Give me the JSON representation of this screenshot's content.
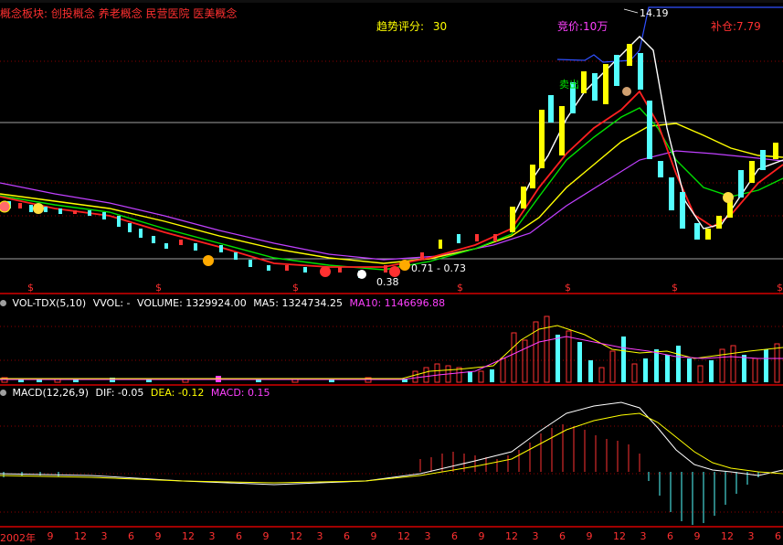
{
  "header": {
    "concept_prefix": "概念板块:",
    "concepts": "创投概念 养老概念 民营医院 医美概念",
    "trend_label": "趋势评分:",
    "trend_value": "30",
    "bid_label": "竞价:",
    "bid_value": "10万",
    "refill_label": "补仓:",
    "refill_value": "7.79"
  },
  "main_chart": {
    "high_label": "14.19",
    "low_label": "0.38",
    "range_label": "0.71 - 0.73",
    "sell_label": "卖出",
    "s_marker": "$"
  },
  "vol_panel": {
    "dot_icon": "circle-icon",
    "indicator": "VOL-TDX(5,10)",
    "vvol": "VVOL: -",
    "volume": "VOLUME: 1329924.00",
    "ma5": "MA5: 1324734.25",
    "ma10": "MA10: 1146696.88"
  },
  "macd_panel": {
    "indicator": "MACD(12,26,9)",
    "dif": "DIF: -0.05",
    "dea": "DEA: -0.12",
    "macd": "MACD: 0.15"
  },
  "x_axis": {
    "labels": [
      "2002年",
      "9",
      "12",
      "3",
      "6",
      "9",
      "12",
      "3",
      "6",
      "9",
      "12",
      "3",
      "6",
      "9",
      "12",
      "3",
      "6",
      "9",
      "12",
      "3",
      "6",
      "9",
      "12",
      "3",
      "6",
      "9",
      "12",
      "3",
      "6"
    ]
  },
  "colors": {
    "background": "#000000",
    "up_candle": "#ff3232",
    "down_candle": "#54ffff",
    "ma_white": "#ffffff",
    "ma_yellow": "#ffff00",
    "ma_green": "#00e000",
    "ma_red": "#ff2020",
    "ma_magenta": "#c040ff",
    "grid": "#8b0000",
    "text_red": "#ff3030",
    "text_yellow": "#ffff00",
    "text_magenta": "#ff40ff"
  }
}
